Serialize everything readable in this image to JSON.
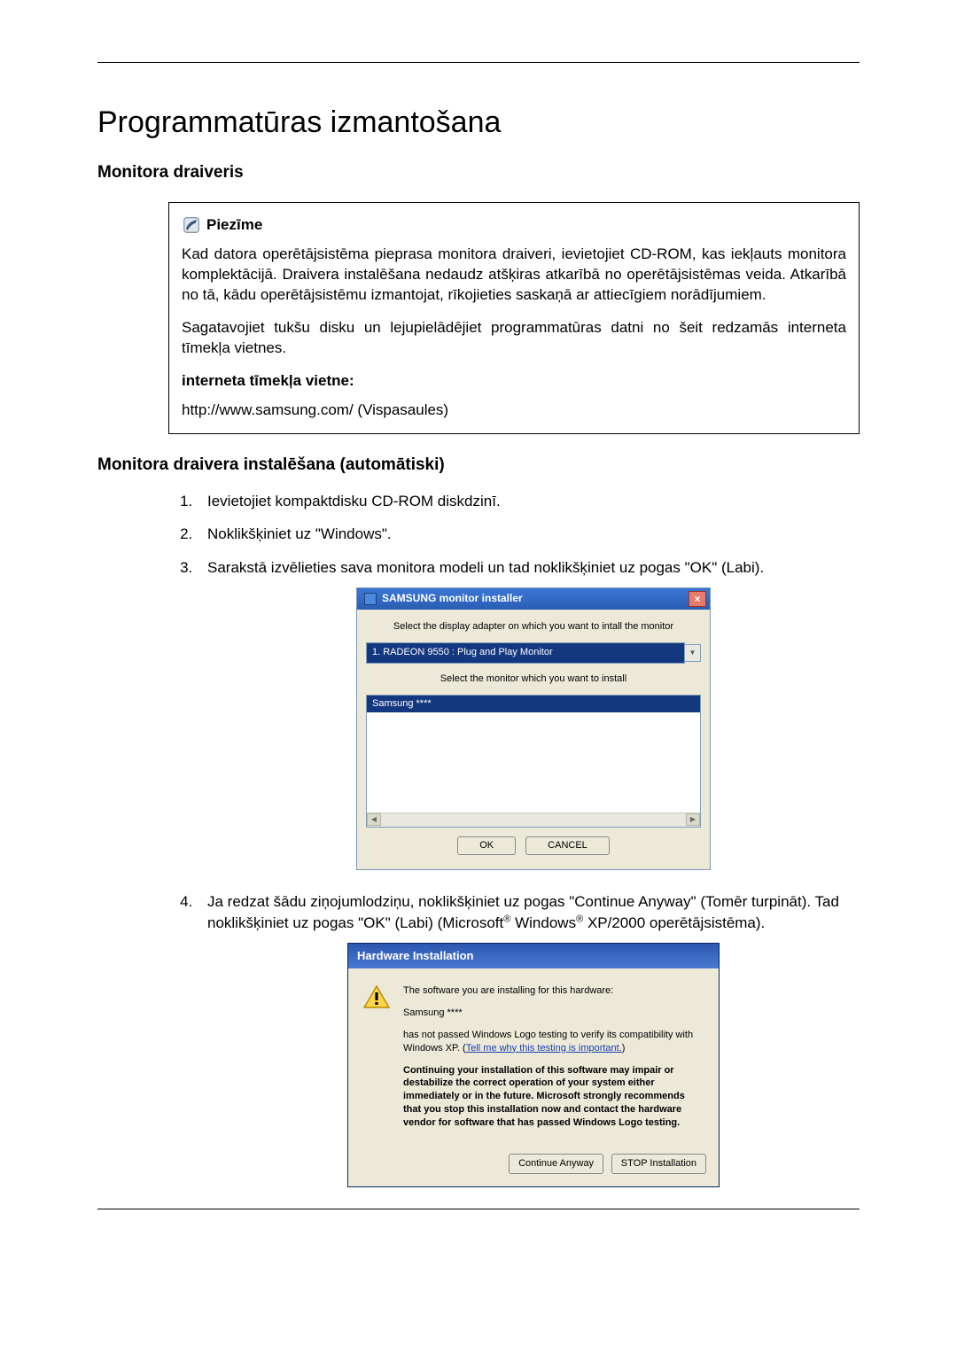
{
  "title": "Programmatūras izmantošana",
  "section1": {
    "heading": "Monitora draiveris",
    "note": {
      "label": "Piezīme",
      "p1": "Kad datora operētājsistēma pieprasa monitora draiveri, ievietojiet CD-ROM, kas iekļauts monitora komplektācijā. Draivera instalēšana nedaudz atšķiras atkarībā no operētājsistēmas veida. Atkarībā no tā, kādu operētājsistēmu izmantojat, rīkojieties saskaņā ar attiecīgiem norādījumiem.",
      "p2": "Sagatavojiet tukšu disku un lejupielādējiet programmatūras datni no šeit redzamās interneta tīmekļa vietnes.",
      "subhead": "interneta tīmekļa vietne:",
      "url": "http://www.samsung.com/ (Vispasaules)"
    }
  },
  "section2": {
    "heading": "Monitora draivera instalēšana (automātiski)",
    "steps": {
      "s1": "Ievietojiet kompaktdisku CD-ROM diskdzinī.",
      "s2": "Noklikšķiniet uz \"Windows\".",
      "s3": "Sarakstā izvēlieties sava monitora modeli un tad noklikšķiniet uz pogas \"OK\" (Labi).",
      "s4_a": "Ja redzat šādu ziņojumlodziņu, noklikšķiniet uz pogas \"Continue Anyway\" (Tomēr turpināt). Tad noklikšķiniet uz pogas \"OK\" (Labi) (Microsoft",
      "s4_b": " Windows",
      "s4_c": " XP/2000 operētājsistēma)."
    }
  },
  "installer": {
    "title": "SAMSUNG monitor installer",
    "inst1": "Select the display adapter on which you want to intall the monitor",
    "combo": "1. RADEON 9550 : Plug and Play Monitor",
    "inst2": "Select the monitor which you want to install",
    "selected": "Samsung ****",
    "ok": "OK",
    "cancel": "CANCEL"
  },
  "hw": {
    "title": "Hardware Installation",
    "p1": "The software you are installing for this hardware:",
    "p2": "Samsung ****",
    "p3a": "has not passed Windows Logo testing to verify its compatibility with Windows XP. (",
    "p3_link": "Tell me why this testing is important.",
    "p3b": ")",
    "p4": "Continuing your installation of this software may impair or destabilize the correct operation of your system either immediately or in the future. Microsoft strongly recommends that you stop this installation now and contact the hardware vendor for software that has passed Windows Logo testing.",
    "btn_continue": "Continue Anyway",
    "btn_stop": "STOP Installation"
  }
}
